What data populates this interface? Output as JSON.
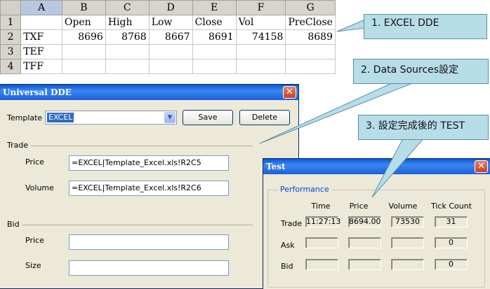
{
  "spreadsheet": {
    "columns": [
      "A",
      "B",
      "C",
      "D",
      "E",
      "F",
      "G"
    ],
    "rows": [
      {
        "num": "1",
        "cells": [
          "",
          "Open",
          "High",
          "Low",
          "Close",
          "Vol",
          "PreClose"
        ]
      },
      {
        "num": "2",
        "cells": [
          "TXF",
          "8696",
          "8768",
          "8667",
          "8691",
          "74158",
          "8689"
        ]
      },
      {
        "num": "3",
        "cells": [
          "TEF",
          "",
          "",
          "",
          "",
          "",
          ""
        ]
      },
      {
        "num": "4",
        "cells": [
          "TFF",
          "",
          "",
          "",
          "",
          "",
          ""
        ]
      }
    ]
  },
  "callouts": {
    "c1": "1. EXCEL DDE",
    "c2": "2. Data Sources設定",
    "c3": "3. 設定完成後的 TEST"
  },
  "dde_window": {
    "title": "Universal DDE",
    "close_glyph": "✕",
    "template_label": "Template",
    "template_value": "EXCEL",
    "save_label": "Save",
    "delete_label": "Delete",
    "trade_section": "Trade",
    "price_label": "Price",
    "price_value": "=EXCEL|Template_Excel.xls!R2C5",
    "volume_label": "Volume",
    "volume_value": "=EXCEL|Template_Excel.xls!R2C6",
    "bid_section": "Bid",
    "bid_price_label": "Price",
    "bid_price_value": "",
    "bid_size_label": "Size",
    "bid_size_value": ""
  },
  "test_window": {
    "title": "Test",
    "close_glyph": "✕",
    "group_title": "Performance",
    "headers": {
      "time": "Time",
      "price": "Price",
      "volume": "Volume",
      "tick_count": "Tick Count"
    },
    "rows": [
      {
        "label": "Trade",
        "time": "11:27:13",
        "price": "8694.00",
        "volume": "73530",
        "tick_count": "31"
      },
      {
        "label": "Ask",
        "time": "",
        "price": "",
        "volume": "",
        "tick_count": "0"
      },
      {
        "label": "Bid",
        "time": "",
        "price": "",
        "volume": "",
        "tick_count": "0"
      }
    ]
  },
  "colors": {
    "titlebar": "#0a58d6",
    "window_bg": "#ece9d8",
    "callout_bg": "#b7dde8",
    "selection": "#316ac5",
    "group_title": "#0046d5"
  }
}
